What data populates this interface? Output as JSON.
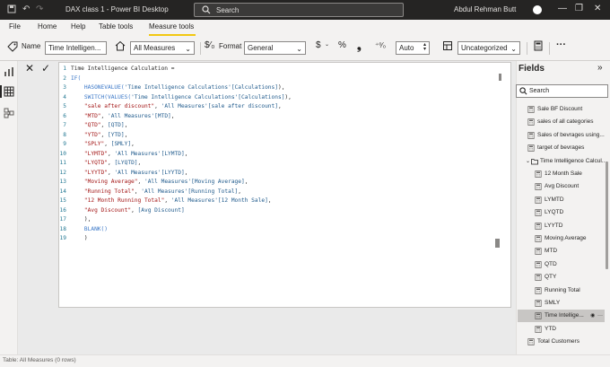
{
  "window": {
    "title": "DAX class 1 - Power BI Desktop",
    "search_placeholder": "Search",
    "user_name": "Abdul Rehman Butt"
  },
  "tabs": [
    "File",
    "Home",
    "Help",
    "Table tools",
    "Measure tools"
  ],
  "active_tab": "Measure tools",
  "ribbon": {
    "name_label": "Name",
    "name_value": "Time Intelligen...",
    "home_table_value": "All Measures",
    "format_label": "Format",
    "format_value": "General",
    "currency_glyph": "$",
    "percent_glyph": "%",
    "comma_glyph": "❟",
    "decimal_arrows": "⁺⁰⁄₀",
    "decimals_value": "Auto",
    "category_value": "Uncategorized",
    "more": "···"
  },
  "formula_bar": {
    "cancel_glyph": "✕",
    "commit_glyph": "✓",
    "lines": [
      {
        "n": "1",
        "parts": [
          {
            "t": "Time Intelligence Calculation = ",
            "c": "pl"
          }
        ]
      },
      {
        "n": "2",
        "parts": [
          {
            "t": "IF(",
            "c": "kw"
          }
        ]
      },
      {
        "n": "3",
        "parts": [
          {
            "t": "    HASONEVALUE(",
            "c": "fn"
          },
          {
            "t": "'Time Intelligence Calculations'[Calculations]",
            "c": "ref"
          },
          {
            "t": "),",
            "c": "pl"
          }
        ]
      },
      {
        "n": "4",
        "parts": [
          {
            "t": "    SWITCH(",
            "c": "fn"
          },
          {
            "t": "VALUES(",
            "c": "fn"
          },
          {
            "t": "'Time Intelligence Calculations'[Calculations]",
            "c": "ref"
          },
          {
            "t": "),",
            "c": "pl"
          }
        ]
      },
      {
        "n": "5",
        "parts": [
          {
            "t": "    \"sale after discount\"",
            "c": "str"
          },
          {
            "t": ", ",
            "c": "pl"
          },
          {
            "t": "'All Measures'[sale after discount]",
            "c": "ref"
          },
          {
            "t": ",",
            "c": "pl"
          }
        ]
      },
      {
        "n": "6",
        "parts": [
          {
            "t": "    \"MTD\"",
            "c": "str"
          },
          {
            "t": ", ",
            "c": "pl"
          },
          {
            "t": "'All Measures'[MTD]",
            "c": "ref"
          },
          {
            "t": ",",
            "c": "pl"
          }
        ]
      },
      {
        "n": "7",
        "parts": [
          {
            "t": "    \"QTD\"",
            "c": "str"
          },
          {
            "t": ", ",
            "c": "pl"
          },
          {
            "t": "[QTD]",
            "c": "ref"
          },
          {
            "t": ",",
            "c": "pl"
          }
        ]
      },
      {
        "n": "8",
        "parts": [
          {
            "t": "    \"YTD\"",
            "c": "str"
          },
          {
            "t": ", ",
            "c": "pl"
          },
          {
            "t": "[YTD]",
            "c": "ref"
          },
          {
            "t": ",",
            "c": "pl"
          }
        ]
      },
      {
        "n": "9",
        "parts": [
          {
            "t": "    \"SPLY\"",
            "c": "str"
          },
          {
            "t": ", ",
            "c": "pl"
          },
          {
            "t": "[SMLY]",
            "c": "ref"
          },
          {
            "t": ",",
            "c": "pl"
          }
        ]
      },
      {
        "n": "10",
        "parts": [
          {
            "t": "    \"LYMTD\"",
            "c": "str"
          },
          {
            "t": ", ",
            "c": "pl"
          },
          {
            "t": "'All Measures'[LYMTD]",
            "c": "ref"
          },
          {
            "t": ",",
            "c": "pl"
          }
        ]
      },
      {
        "n": "11",
        "parts": [
          {
            "t": "    \"LYQTD\"",
            "c": "str"
          },
          {
            "t": ", ",
            "c": "pl"
          },
          {
            "t": "[LYQTD]",
            "c": "ref"
          },
          {
            "t": ",",
            "c": "pl"
          }
        ]
      },
      {
        "n": "12",
        "parts": [
          {
            "t": "    \"LYYTD\"",
            "c": "str"
          },
          {
            "t": ", ",
            "c": "pl"
          },
          {
            "t": "'All Measures'[LYYTD]",
            "c": "ref"
          },
          {
            "t": ",",
            "c": "pl"
          }
        ]
      },
      {
        "n": "13",
        "parts": [
          {
            "t": "    \"Moving Average\"",
            "c": "str"
          },
          {
            "t": ", ",
            "c": "pl"
          },
          {
            "t": "'All Measures'[Moving Average]",
            "c": "ref"
          },
          {
            "t": ",",
            "c": "pl"
          }
        ]
      },
      {
        "n": "14",
        "parts": [
          {
            "t": "    \"Running Total\"",
            "c": "str"
          },
          {
            "t": ", ",
            "c": "pl"
          },
          {
            "t": "'All Measures'[Running Total]",
            "c": "ref"
          },
          {
            "t": ",",
            "c": "pl"
          }
        ]
      },
      {
        "n": "15",
        "parts": [
          {
            "t": "    \"12 Month Running Total\"",
            "c": "str"
          },
          {
            "t": ", ",
            "c": "pl"
          },
          {
            "t": "'All Measures'[12 Month Sale]",
            "c": "ref"
          },
          {
            "t": ",",
            "c": "pl"
          }
        ]
      },
      {
        "n": "16",
        "parts": [
          {
            "t": "    \"Avg Discount\"",
            "c": "str"
          },
          {
            "t": ", ",
            "c": "pl"
          },
          {
            "t": "[Avg Discount]",
            "c": "ref"
          }
        ]
      },
      {
        "n": "17",
        "parts": [
          {
            "t": "    ),",
            "c": "pl"
          }
        ]
      },
      {
        "n": "18",
        "parts": [
          {
            "t": "    BLANK()",
            "c": "fn"
          }
        ]
      },
      {
        "n": "19",
        "parts": [
          {
            "t": "    )",
            "c": "pl"
          }
        ]
      }
    ]
  },
  "fields": {
    "title": "Fields",
    "collapse_glyph": "»",
    "search_placeholder": "Search",
    "items": [
      {
        "label": "Sale BF Discount",
        "icon": "calculator-icon",
        "indent": 1
      },
      {
        "label": "sales of all categories",
        "icon": "calculator-icon",
        "indent": 1
      },
      {
        "label": "Sales of bevrages using...",
        "icon": "calculator-icon",
        "indent": 1
      },
      {
        "label": "target of bevrages",
        "icon": "calculator-icon",
        "indent": 1
      },
      {
        "label": "Time Intelligence Calcul...",
        "icon": "folder-icon",
        "indent": 0
      },
      {
        "label": "12 Month Sale",
        "icon": "calculator-icon",
        "indent": 2
      },
      {
        "label": "Avg Discount",
        "icon": "calculator-icon",
        "indent": 2
      },
      {
        "label": "LYMTD",
        "icon": "calculator-icon",
        "indent": 2
      },
      {
        "label": "LYQTD",
        "icon": "calculator-icon",
        "indent": 2
      },
      {
        "label": "LYYTD",
        "icon": "calculator-icon",
        "indent": 2
      },
      {
        "label": "Moving Average",
        "icon": "calculator-icon",
        "indent": 2
      },
      {
        "label": "MTD",
        "icon": "calculator-icon",
        "indent": 2
      },
      {
        "label": "QTD",
        "icon": "calculator-icon",
        "indent": 2
      },
      {
        "label": "QTY",
        "icon": "calculator-icon",
        "indent": 2
      },
      {
        "label": "Running Total",
        "icon": "calculator-icon",
        "indent": 2
      },
      {
        "label": "SMLY",
        "icon": "calculator-icon",
        "indent": 2
      },
      {
        "label": "Time Intellige...",
        "icon": "calculator-icon",
        "indent": 2,
        "selected": true
      },
      {
        "label": "YTD",
        "icon": "calculator-icon",
        "indent": 2
      },
      {
        "label": "Total Customers",
        "icon": "calculator-icon",
        "indent": 1
      }
    ]
  },
  "status_bar": {
    "text": "Table: All Measures (0 rows)"
  },
  "colors": {
    "accent_tab_underline": "#f2c811",
    "title_bar": "#252423",
    "code_keyword": "#3b78c8",
    "code_string": "#a31515",
    "line_number": "#237893"
  }
}
